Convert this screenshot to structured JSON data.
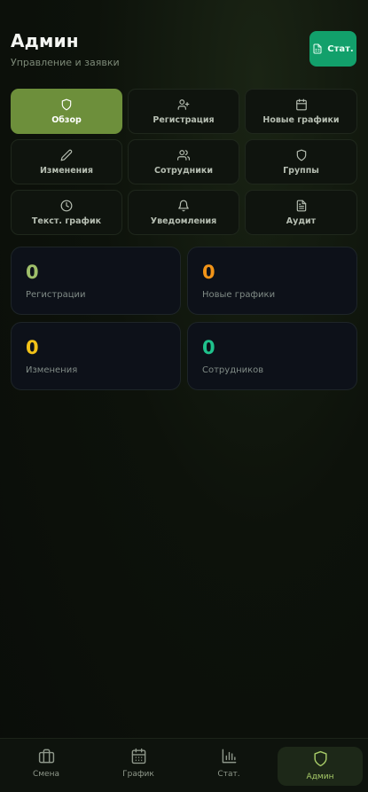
{
  "header": {
    "title": "Админ",
    "subtitle": "Управление и заявки",
    "stat_button_label": "Стат."
  },
  "tabs": [
    {
      "label": "Обзор",
      "icon": "shield-icon",
      "active": true
    },
    {
      "label": "Регистрация",
      "icon": "user-plus-icon",
      "active": false
    },
    {
      "label": "Новые графики",
      "icon": "calendar-icon",
      "active": false
    },
    {
      "label": "Изменения",
      "icon": "pencil-icon",
      "active": false
    },
    {
      "label": "Сотрудники",
      "icon": "users-icon",
      "active": false
    },
    {
      "label": "Группы",
      "icon": "shield-icon",
      "active": false
    },
    {
      "label": "Текст. график",
      "icon": "clock-icon",
      "active": false
    },
    {
      "label": "Уведомления",
      "icon": "bell-icon",
      "active": false
    },
    {
      "label": "Аудит",
      "icon": "file-text-icon",
      "active": false
    }
  ],
  "stats": [
    {
      "value": "0",
      "label": "Регистрации",
      "color": "#9fbf6a"
    },
    {
      "value": "0",
      "label": "Новые графики",
      "color": "#f29418"
    },
    {
      "value": "0",
      "label": "Изменения",
      "color": "#f2c218"
    },
    {
      "value": "0",
      "label": "Сотрудников",
      "color": "#1fc28c"
    }
  ],
  "bottom_nav": [
    {
      "label": "Смена",
      "icon": "briefcase-icon",
      "active": false
    },
    {
      "label": "График",
      "icon": "calendar-grid-icon",
      "active": false
    },
    {
      "label": "Стат.",
      "icon": "bar-chart-icon",
      "active": false
    },
    {
      "label": "Админ",
      "icon": "shield-icon",
      "active": true
    }
  ],
  "colors": {
    "accent": "#6d8f3b",
    "stat_button": "#12a06b",
    "background": "#0b0f0a"
  }
}
